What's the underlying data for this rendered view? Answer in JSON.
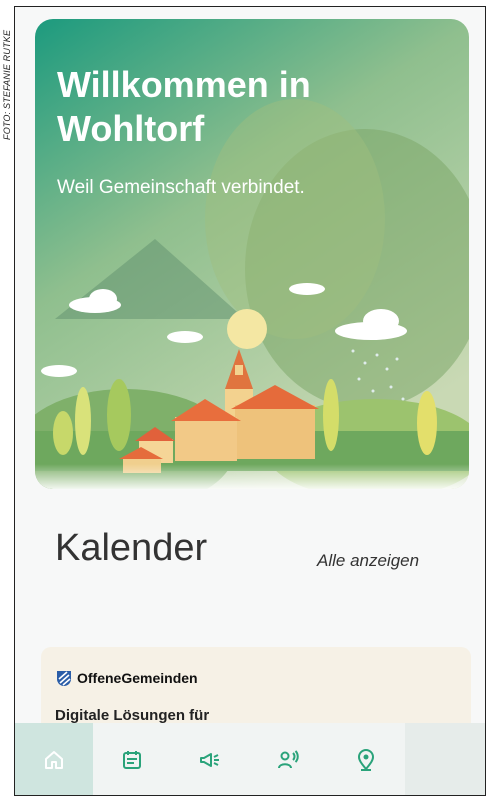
{
  "photo_credit": "FOTO: STEFANIE RUTKE",
  "hero": {
    "title": "Willkommen in Wohltorf",
    "subtitle": "Weil Gemeinschaft verbindet."
  },
  "calendar": {
    "title": "Kalender",
    "show_all": "Alle anzeigen"
  },
  "card": {
    "brand": "OffeneGemeinden",
    "text": "Digitale Lösungen für"
  },
  "nav": {
    "items": [
      {
        "icon": "home-icon",
        "active": true
      },
      {
        "icon": "calendar-icon",
        "active": false
      },
      {
        "icon": "megaphone-icon",
        "active": false
      },
      {
        "icon": "person-voice-icon",
        "active": false
      },
      {
        "icon": "location-pin-icon",
        "active": false
      }
    ]
  },
  "colors": {
    "accent": "#2aa37a",
    "hero_top": "#1f9b7f",
    "card_bg": "#f6f1e6"
  }
}
